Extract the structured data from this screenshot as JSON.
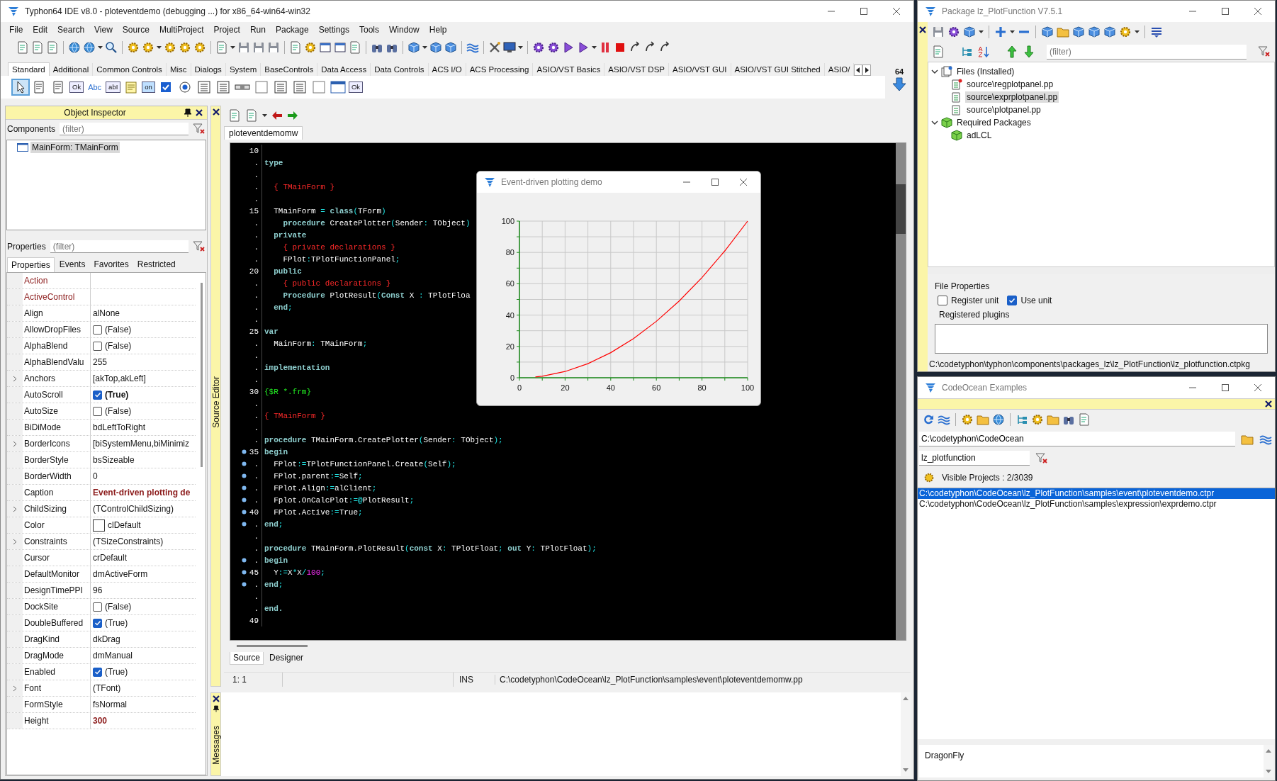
{
  "ide": {
    "title": "Typhon64 IDE v8.0 - ploteventdemo (debugging ...) for x86_64-win64-win32",
    "menu": [
      "File",
      "Edit",
      "Search",
      "View",
      "Source",
      "MultiProject",
      "Project",
      "Run",
      "Package",
      "Settings",
      "Tools",
      "Window",
      "Help"
    ],
    "palette_tabs": [
      {
        "label": "Standard",
        "selected": true
      },
      {
        "label": "Additional",
        "selected": false
      },
      {
        "label": "Common Controls",
        "selected": false
      },
      {
        "label": "Misc",
        "selected": false
      },
      {
        "label": "Dialogs",
        "selected": false
      },
      {
        "label": "System",
        "selected": false
      },
      {
        "label": "BaseControls",
        "selected": false
      },
      {
        "label": "Data Access",
        "selected": false
      },
      {
        "label": "Data Controls",
        "selected": false
      },
      {
        "label": "ACS I/O",
        "selected": false
      },
      {
        "label": "ACS Processing",
        "selected": false
      },
      {
        "label": "ASIO/VST Basics",
        "selected": false
      },
      {
        "label": "ASIO/VST DSP",
        "selected": false
      },
      {
        "label": "ASIO/VST GUI",
        "selected": false
      },
      {
        "label": "ASIO/VST GUI Stitched",
        "selected": false
      },
      {
        "label": "ASIO/",
        "selected": false
      }
    ],
    "palette_badge": "64",
    "palette": [
      {
        "kind": "pointer",
        "selected": true
      },
      {
        "kind": "doc",
        "selected": false
      },
      {
        "kind": "doc",
        "selected": false
      },
      {
        "kind": "button",
        "caption": "Ok",
        "selected": false
      },
      {
        "kind": "label",
        "caption": "Abc",
        "selected": false
      },
      {
        "kind": "edit",
        "caption": "abI",
        "selected": false
      },
      {
        "kind": "note",
        "selected": false
      },
      {
        "kind": "toggle",
        "caption": "on",
        "selected": false
      },
      {
        "kind": "check",
        "selected": false
      },
      {
        "kind": "radio",
        "selected": false
      },
      {
        "kind": "list",
        "selected": false
      },
      {
        "kind": "list",
        "selected": false
      },
      {
        "kind": "scrollbar",
        "selected": false
      },
      {
        "kind": "blank",
        "selected": false
      },
      {
        "kind": "list",
        "selected": false
      },
      {
        "kind": "list",
        "selected": false
      },
      {
        "kind": "blank",
        "selected": false
      },
      {
        "kind": "frame",
        "selected": false
      },
      {
        "kind": "button",
        "caption": "Ok",
        "selected": false
      }
    ]
  },
  "object_inspector": {
    "title": "Object Inspector",
    "components_label": "Components",
    "components_filter": {
      "placeholder": "(filter)"
    },
    "tree": [
      {
        "label": "MainForm: TMainForm",
        "selected": true
      }
    ],
    "properties_label": "Properties",
    "properties_filter": {
      "placeholder": "(filter)"
    },
    "tabs": [
      {
        "label": "Properties",
        "selected": true
      },
      {
        "label": "Events",
        "selected": false
      },
      {
        "label": "Favorites",
        "selected": false
      },
      {
        "label": "Restricted",
        "selected": false
      }
    ],
    "properties": [
      {
        "name": "Action",
        "kind": "text",
        "expandable": false,
        "name_highlight": true,
        "bold": false,
        "value_highlight": false
      },
      {
        "name": "ActiveControl",
        "kind": "text",
        "expandable": false,
        "name_highlight": true,
        "bold": false,
        "value_highlight": false
      },
      {
        "name": "Align",
        "value": "alNone",
        "kind": "text",
        "expandable": false,
        "name_highlight": false,
        "bold": false,
        "value_highlight": false
      },
      {
        "name": "AllowDropFiles",
        "value": "(False)",
        "kind": "check",
        "checked": false,
        "expandable": false,
        "name_highlight": false,
        "bold": false,
        "value_highlight": false
      },
      {
        "name": "AlphaBlend",
        "value": "(False)",
        "kind": "check",
        "checked": false,
        "expandable": false,
        "name_highlight": false,
        "bold": false,
        "value_highlight": false
      },
      {
        "name": "AlphaBlendValu",
        "value": "255",
        "kind": "text",
        "expandable": false,
        "name_highlight": false,
        "bold": false,
        "value_highlight": false
      },
      {
        "name": "Anchors",
        "value": "[akTop,akLeft]",
        "kind": "text",
        "expandable": true,
        "name_highlight": false,
        "bold": false,
        "value_highlight": false
      },
      {
        "name": "AutoScroll",
        "value": "(True)",
        "kind": "check",
        "checked": true,
        "expandable": false,
        "name_highlight": false,
        "bold": true,
        "value_highlight": false
      },
      {
        "name": "AutoSize",
        "value": "(False)",
        "kind": "check",
        "checked": false,
        "expandable": false,
        "name_highlight": false,
        "bold": false,
        "value_highlight": false
      },
      {
        "name": "BiDiMode",
        "value": "bdLeftToRight",
        "kind": "text",
        "expandable": false,
        "name_highlight": false,
        "bold": false,
        "value_highlight": false
      },
      {
        "name": "BorderIcons",
        "value": "[biSystemMenu,biMinimiz",
        "kind": "text",
        "expandable": true,
        "name_highlight": false,
        "bold": false,
        "value_highlight": false
      },
      {
        "name": "BorderStyle",
        "value": "bsSizeable",
        "kind": "text",
        "expandable": false,
        "name_highlight": false,
        "bold": false,
        "value_highlight": false
      },
      {
        "name": "BorderWidth",
        "value": "0",
        "kind": "text",
        "expandable": false,
        "name_highlight": false,
        "bold": false,
        "value_highlight": false
      },
      {
        "name": "Caption",
        "value": "Event-driven plotting de",
        "kind": "text",
        "expandable": false,
        "name_highlight": false,
        "bold": true,
        "value_highlight": true
      },
      {
        "name": "ChildSizing",
        "value": "(TControlChildSizing)",
        "kind": "text",
        "expandable": true,
        "name_highlight": false,
        "bold": false,
        "value_highlight": false
      },
      {
        "name": "Color",
        "value": "clDefault",
        "kind": "color",
        "expandable": false,
        "name_highlight": false,
        "bold": false,
        "value_highlight": false
      },
      {
        "name": "Constraints",
        "value": "(TSizeConstraints)",
        "kind": "text",
        "expandable": true,
        "name_highlight": false,
        "bold": false,
        "value_highlight": false
      },
      {
        "name": "Cursor",
        "value": "crDefault",
        "kind": "text",
        "expandable": false,
        "name_highlight": false,
        "bold": false,
        "value_highlight": false
      },
      {
        "name": "DefaultMonitor",
        "value": "dmActiveForm",
        "kind": "text",
        "expandable": false,
        "name_highlight": false,
        "bold": false,
        "value_highlight": false
      },
      {
        "name": "DesignTimePPI",
        "value": "96",
        "kind": "text",
        "expandable": false,
        "name_highlight": false,
        "bold": false,
        "value_highlight": false
      },
      {
        "name": "DockSite",
        "value": "(False)",
        "kind": "check",
        "checked": false,
        "expandable": false,
        "name_highlight": false,
        "bold": false,
        "value_highlight": false
      },
      {
        "name": "DoubleBuffered",
        "value": "(True)",
        "kind": "check",
        "checked": true,
        "expandable": false,
        "name_highlight": false,
        "bold": false,
        "value_highlight": false
      },
      {
        "name": "DragKind",
        "value": "dkDrag",
        "kind": "text",
        "expandable": false,
        "name_highlight": false,
        "bold": false,
        "value_highlight": false
      },
      {
        "name": "DragMode",
        "value": "dmManual",
        "kind": "text",
        "expandable": false,
        "name_highlight": false,
        "bold": false,
        "value_highlight": false
      },
      {
        "name": "Enabled",
        "value": "(True)",
        "kind": "check",
        "checked": true,
        "expandable": false,
        "name_highlight": false,
        "bold": false,
        "value_highlight": false
      },
      {
        "name": "Font",
        "value": "(TFont)",
        "kind": "text",
        "expandable": true,
        "name_highlight": false,
        "bold": false,
        "value_highlight": false
      },
      {
        "name": "FormStyle",
        "value": "fsNormal",
        "kind": "text",
        "expandable": false,
        "name_highlight": false,
        "bold": false,
        "value_highlight": false
      },
      {
        "name": "Height",
        "value": "300",
        "kind": "text",
        "expandable": false,
        "name_highlight": false,
        "bold": true,
        "value_highlight": true
      }
    ]
  },
  "source_editor": {
    "dock_label": "Source Editor",
    "file_tabs": [
      {
        "label": "ploteventdemomw",
        "selected": true
      }
    ],
    "lines": [
      {
        "gutter": "10",
        "breakpoint": false
      },
      {
        "gutter": ".",
        "breakpoint": false,
        "tokens": [
          {
            "kind": "kw",
            "text": "type"
          }
        ]
      },
      {
        "gutter": ".",
        "breakpoint": false
      },
      {
        "gutter": ".",
        "breakpoint": false,
        "tokens": [
          {
            "kind": "comment",
            "text": "  { TMainForm }"
          }
        ]
      },
      {
        "gutter": ".",
        "breakpoint": false
      },
      {
        "gutter": "15",
        "breakpoint": false,
        "tokens": [
          {
            "kind": "id",
            "text": "  TMainForm "
          },
          {
            "kind": "sym",
            "text": "="
          },
          {
            "kind": "kw",
            "text": " class"
          },
          {
            "kind": "sym",
            "text": "("
          },
          {
            "kind": "id",
            "text": "TForm"
          },
          {
            "kind": "sym",
            "text": ")"
          }
        ]
      },
      {
        "gutter": ".",
        "breakpoint": false,
        "tokens": [
          {
            "kind": "kw",
            "text": "    procedure"
          },
          {
            "kind": "id",
            "text": " CreatePlotter"
          },
          {
            "kind": "sym",
            "text": "("
          },
          {
            "kind": "id",
            "text": "Sender"
          },
          {
            "kind": "sym",
            "text": ":"
          },
          {
            "kind": "id",
            "text": " TObject"
          },
          {
            "kind": "sym",
            "text": ")"
          }
        ]
      },
      {
        "gutter": ".",
        "breakpoint": false,
        "tokens": [
          {
            "kind": "kw",
            "text": "  private"
          }
        ]
      },
      {
        "gutter": ".",
        "breakpoint": false,
        "tokens": [
          {
            "kind": "comment",
            "text": "    { private declarations }"
          }
        ]
      },
      {
        "gutter": ".",
        "breakpoint": false,
        "tokens": [
          {
            "kind": "id",
            "text": "    FPlot"
          },
          {
            "kind": "sym",
            "text": ":"
          },
          {
            "kind": "id",
            "text": "TPlotFunctionPanel"
          },
          {
            "kind": "sym",
            "text": ";"
          }
        ]
      },
      {
        "gutter": "20",
        "breakpoint": false,
        "tokens": [
          {
            "kind": "kw",
            "text": "  public"
          }
        ]
      },
      {
        "gutter": ".",
        "breakpoint": false,
        "tokens": [
          {
            "kind": "comment",
            "text": "    { public declarations }"
          }
        ]
      },
      {
        "gutter": ".",
        "breakpoint": false,
        "tokens": [
          {
            "kind": "kw",
            "text": "    Procedure"
          },
          {
            "kind": "id",
            "text": " PlotResult"
          },
          {
            "kind": "sym",
            "text": "("
          },
          {
            "kind": "kw",
            "text": "Const"
          },
          {
            "kind": "id",
            "text": " X "
          },
          {
            "kind": "sym",
            "text": ":"
          },
          {
            "kind": "id",
            "text": " TPlotFloa"
          }
        ]
      },
      {
        "gutter": ".",
        "breakpoint": false,
        "tokens": [
          {
            "kind": "kw",
            "text": "  end"
          },
          {
            "kind": "sym",
            "text": ";"
          }
        ]
      },
      {
        "gutter": ".",
        "breakpoint": false
      },
      {
        "gutter": "25",
        "breakpoint": false,
        "tokens": [
          {
            "kind": "kw",
            "text": "var"
          }
        ]
      },
      {
        "gutter": ".",
        "breakpoint": false,
        "tokens": [
          {
            "kind": "id",
            "text": "  MainForm"
          },
          {
            "kind": "sym",
            "text": ":"
          },
          {
            "kind": "id",
            "text": " TMainForm"
          },
          {
            "kind": "sym",
            "text": ";"
          }
        ]
      },
      {
        "gutter": ".",
        "breakpoint": false
      },
      {
        "gutter": ".",
        "breakpoint": false,
        "tokens": [
          {
            "kind": "kw",
            "text": "implementation"
          }
        ]
      },
      {
        "gutter": ".",
        "breakpoint": false
      },
      {
        "gutter": "30",
        "breakpoint": false,
        "tokens": [
          {
            "kind": "directive",
            "text": "{$R *.frm}"
          }
        ]
      },
      {
        "gutter": ".",
        "breakpoint": false
      },
      {
        "gutter": ".",
        "breakpoint": false,
        "tokens": [
          {
            "kind": "comment",
            "text": "{ TMainForm }"
          }
        ]
      },
      {
        "gutter": ".",
        "breakpoint": false
      },
      {
        "gutter": ".",
        "breakpoint": false,
        "tokens": [
          {
            "kind": "kw",
            "text": "procedure"
          },
          {
            "kind": "id",
            "text": " TMainForm.CreatePlotter"
          },
          {
            "kind": "sym",
            "text": "("
          },
          {
            "kind": "id",
            "text": "Sender"
          },
          {
            "kind": "sym",
            "text": ":"
          },
          {
            "kind": "id",
            "text": " TObject"
          },
          {
            "kind": "sym",
            "text": ");"
          }
        ]
      },
      {
        "gutter": "35",
        "breakpoint": true,
        "tokens": [
          {
            "kind": "kw",
            "text": "begin"
          }
        ]
      },
      {
        "gutter": ".",
        "breakpoint": true,
        "tokens": [
          {
            "kind": "id",
            "text": "  FPlot"
          },
          {
            "kind": "sym",
            "text": ":="
          },
          {
            "kind": "id",
            "text": "TPlotFunctionPanel.Create"
          },
          {
            "kind": "sym",
            "text": "("
          },
          {
            "kind": "id",
            "text": "Self"
          },
          {
            "kind": "sym",
            "text": ");"
          }
        ]
      },
      {
        "gutter": ".",
        "breakpoint": true,
        "tokens": [
          {
            "kind": "id",
            "text": "  FPlot.parent"
          },
          {
            "kind": "sym",
            "text": ":="
          },
          {
            "kind": "id",
            "text": "Self"
          },
          {
            "kind": "sym",
            "text": ";"
          }
        ]
      },
      {
        "gutter": ".",
        "breakpoint": true,
        "tokens": [
          {
            "kind": "id",
            "text": "  FPlot.Align"
          },
          {
            "kind": "sym",
            "text": ":="
          },
          {
            "kind": "id",
            "text": "alClient"
          },
          {
            "kind": "sym",
            "text": ";"
          }
        ]
      },
      {
        "gutter": ".",
        "breakpoint": true,
        "tokens": [
          {
            "kind": "id",
            "text": "  Fplot.OnCalcPlot"
          },
          {
            "kind": "sym",
            "text": ":=@"
          },
          {
            "kind": "id",
            "text": "PlotResult"
          },
          {
            "kind": "sym",
            "text": ";"
          }
        ]
      },
      {
        "gutter": "40",
        "breakpoint": true,
        "tokens": [
          {
            "kind": "id",
            "text": "  FPlot.Active"
          },
          {
            "kind": "sym",
            "text": ":="
          },
          {
            "kind": "id",
            "text": "True"
          },
          {
            "kind": "sym",
            "text": ";"
          }
        ]
      },
      {
        "gutter": ".",
        "breakpoint": true,
        "tokens": [
          {
            "kind": "kw",
            "text": "end"
          },
          {
            "kind": "sym",
            "text": ";"
          }
        ]
      },
      {
        "gutter": ".",
        "breakpoint": false
      },
      {
        "gutter": ".",
        "breakpoint": false,
        "tokens": [
          {
            "kind": "kw",
            "text": "procedure"
          },
          {
            "kind": "id",
            "text": " TMainForm.PlotResult"
          },
          {
            "kind": "sym",
            "text": "("
          },
          {
            "kind": "kw",
            "text": "const"
          },
          {
            "kind": "id",
            "text": " X"
          },
          {
            "kind": "sym",
            "text": ":"
          },
          {
            "kind": "id",
            "text": " TPlotFloat"
          },
          {
            "kind": "sym",
            "text": ";"
          },
          {
            "kind": "kw",
            "text": " out"
          },
          {
            "kind": "id",
            "text": " Y"
          },
          {
            "kind": "sym",
            "text": ":"
          },
          {
            "kind": "id",
            "text": " TPlotFloat"
          },
          {
            "kind": "sym",
            "text": ");"
          }
        ]
      },
      {
        "gutter": ".",
        "breakpoint": true,
        "tokens": [
          {
            "kind": "kw",
            "text": "begin"
          }
        ]
      },
      {
        "gutter": "45",
        "breakpoint": true,
        "tokens": [
          {
            "kind": "id",
            "text": "  Y"
          },
          {
            "kind": "sym",
            "text": ":="
          },
          {
            "kind": "id",
            "text": "X"
          },
          {
            "kind": "sym",
            "text": "*"
          },
          {
            "kind": "id",
            "text": "X"
          },
          {
            "kind": "sym",
            "text": "/"
          },
          {
            "kind": "num",
            "text": "100"
          },
          {
            "kind": "sym",
            "text": ";"
          }
        ]
      },
      {
        "gutter": ".",
        "breakpoint": true,
        "tokens": [
          {
            "kind": "kw",
            "text": "end"
          },
          {
            "kind": "sym",
            "text": ";"
          }
        ]
      },
      {
        "gutter": ".",
        "breakpoint": false
      },
      {
        "gutter": ".",
        "breakpoint": false,
        "tokens": [
          {
            "kind": "kw",
            "text": "end."
          }
        ]
      },
      {
        "gutter": "49",
        "breakpoint": false
      }
    ],
    "bottom_tabs": [
      {
        "label": "Source",
        "selected": true
      },
      {
        "label": "Designer",
        "selected": false
      }
    ],
    "status": {
      "position": "1:  1",
      "mode": "INS",
      "path": "C:\\codetyphon\\CodeOcean\\lz_PlotFunction\\samples\\event\\ploteventdemomw.pp"
    }
  },
  "messages": {
    "dock_label": "Messages"
  },
  "plot_window": {
    "title": "Event-driven plotting demo",
    "chart_data": {
      "type": "line",
      "x": [
        7,
        10,
        20,
        30,
        40,
        50,
        60,
        70,
        80,
        90,
        100
      ],
      "xlim": [
        0,
        100
      ],
      "ylim": [
        0,
        100
      ],
      "xticks": [
        0,
        20,
        40,
        60,
        80,
        100
      ],
      "yticks": [
        0,
        20,
        40,
        60,
        80,
        100
      ],
      "grid": true,
      "series": [
        {
          "color": "#ff0000",
          "values": [
            0.5,
            1,
            4,
            9,
            16,
            25,
            36,
            49,
            64,
            81,
            100
          ]
        }
      ]
    }
  },
  "package_window": {
    "title": "Package lz_PlotFunction V7.5.1",
    "filter": {
      "placeholder": "(filter)"
    },
    "tree": [
      {
        "label": "Files  (Installed)",
        "kind": "files",
        "expanded": true,
        "selected": false,
        "children": [
          {
            "label": "source\\regplotpanel.pp",
            "kind": "unit_registered",
            "selected": false
          },
          {
            "label": "source\\exprplotpanel.pp",
            "kind": "unit",
            "selected": true
          },
          {
            "label": "source\\plotpanel.pp",
            "kind": "unit",
            "selected": false
          }
        ]
      },
      {
        "label": "Required Packages",
        "kind": "package",
        "expanded": true,
        "selected": false,
        "children": [
          {
            "label": "adLCL",
            "kind": "package",
            "selected": false
          }
        ]
      }
    ],
    "file_properties": {
      "title": "File Properties",
      "options": [
        {
          "label": "Register unit",
          "checked": false
        },
        {
          "label": "Use unit",
          "checked": true
        }
      ],
      "plugins_title": "Registered plugins"
    },
    "status": "C:\\codetyphon\\typhon\\components\\packages_lz\\lz_PlotFunction\\lz_plotfunction.ctpkg"
  },
  "codeocean": {
    "title": "CodeOcean Examples",
    "path_field": {
      "value": "C:\\codetyphon\\CodeOcean"
    },
    "filter_field": {
      "value": "lz_plotfunction"
    },
    "visible_projects": "Visible Projects : 2/3039",
    "projects": [
      {
        "label": "C:\\codetyphon\\CodeOcean\\lz_PlotFunction\\samples\\event\\ploteventdemo.ctpr",
        "selected": true
      },
      {
        "label": "C:\\codetyphon\\CodeOcean\\lz_PlotFunction\\samples\\expression\\exprdemo.ctpr",
        "selected": false
      }
    ],
    "description": "DragonFly"
  }
}
